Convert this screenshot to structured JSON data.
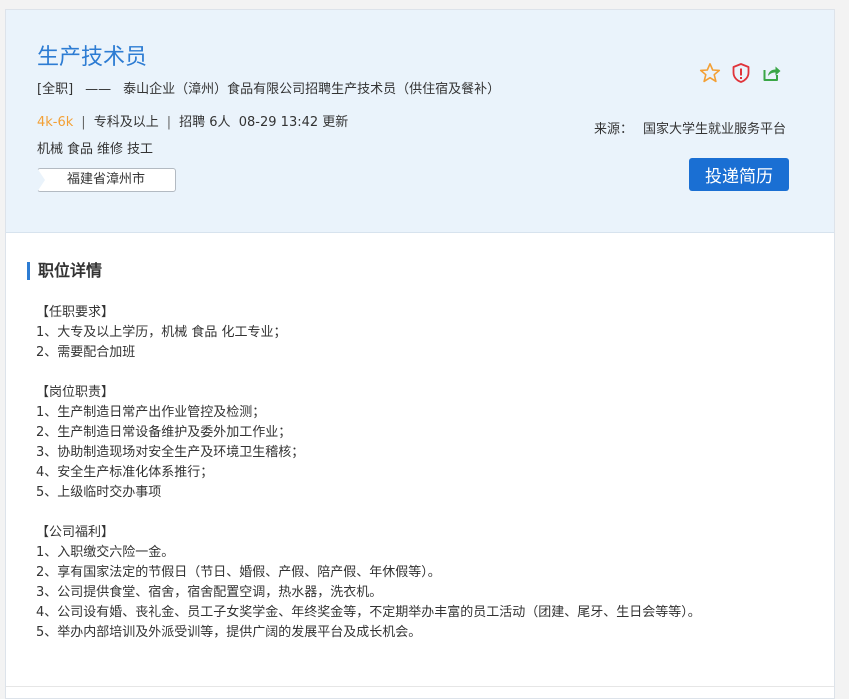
{
  "job": {
    "title": "生产技术员",
    "type_tag": "[全职]",
    "dash": "——",
    "subtitle": "泰山企业（漳州）食品有限公司招聘生产技术员（供住宿及餐补）",
    "salary": "4k-6k",
    "education": "专科及以上",
    "recruit": "招聘 6人",
    "updated": "08-29 13:42 更新",
    "meta_sep": "|",
    "tags": [
      "机械",
      "食品",
      "维修",
      "技工"
    ],
    "location": "福建省漳州市",
    "source_label": "来源：",
    "source_value": "国家大学生就业服务平台",
    "apply_label": "投递简历"
  },
  "icons": [
    "star-icon",
    "report-shield-icon",
    "share-icon"
  ],
  "colors": {
    "title": "#2d7cd3",
    "salary": "#f3a035",
    "apply_button": "#1a6fd3",
    "star": "#f3a035",
    "report": "#e0333a",
    "share": "#3aa646"
  },
  "detail": {
    "heading": "职位详情",
    "groups": [
      {
        "title": "【任职要求】",
        "lines": [
          "1、大专及以上学历，机械 食品 化工专业；",
          "2、需要配合加班"
        ]
      },
      {
        "title": "【岗位职责】",
        "lines": [
          "1、生产制造日常产出作业管控及检测；",
          "2、生产制造日常设备维护及委外加工作业；",
          "3、协助制造现场对安全生产及环境卫生稽核；",
          "4、安全生产标准化体系推行；",
          "5、上级临时交办事项"
        ]
      },
      {
        "title": "【公司福利】",
        "lines": [
          "1、入职缴交六险一金。",
          "2、享有国家法定的节假日（节日、婚假、产假、陪产假、年休假等）。",
          "3、公司提供食堂、宿舍，宿舍配置空调，热水器，洗衣机。",
          "4、公司设有婚、丧礼金、员工子女奖学金、年终奖金等，不定期举办丰富的员工活动（团建、尾牙、生日会等等）。",
          "5、举办内部培训及外派受训等，提供广阔的发展平台及成长机会。"
        ]
      }
    ]
  }
}
